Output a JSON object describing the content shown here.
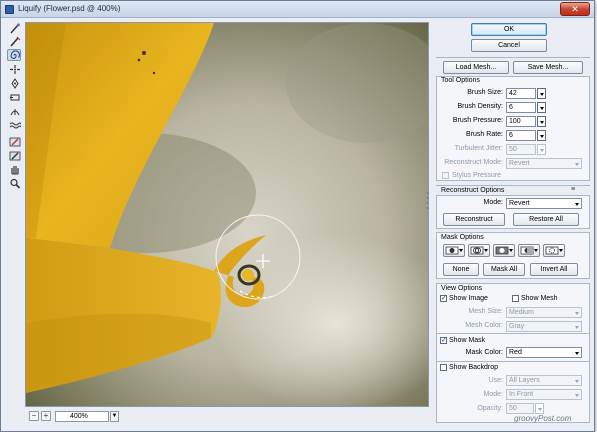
{
  "window": {
    "title": "Liquify (Flower.psd @ 400%)",
    "close_glyph": "✕"
  },
  "toolbar": {
    "tools": [
      "forward-warp-tool",
      "reconstruct-tool",
      "twirl-clockwise-tool",
      "pucker-tool",
      "bloat-tool",
      "push-left-tool",
      "mirror-tool",
      "turbulence-tool",
      "freeze-mask-tool",
      "thaw-mask-tool",
      "hand-tool",
      "zoom-tool"
    ]
  },
  "zoom": {
    "minus": "−",
    "plus": "+",
    "value": "400%"
  },
  "buttons": {
    "ok": "OK",
    "cancel": "Cancel",
    "load_mesh": "Load Mesh...",
    "save_mesh": "Save Mesh..."
  },
  "tool_options": {
    "title": "Tool Options",
    "brush_size_label": "Brush Size:",
    "brush_size": "42",
    "brush_density_label": "Brush Density:",
    "brush_density": "6",
    "brush_pressure_label": "Brush Pressure:",
    "brush_pressure": "100",
    "brush_rate_label": "Brush Rate:",
    "brush_rate": "6",
    "turbulent_jitter_label": "Turbulent Jitter:",
    "turbulent_jitter": "50",
    "reconstruct_mode_label": "Reconstruct Mode:",
    "reconstruct_mode": "Revert",
    "stylus_pressure_label": "Stylus Pressure"
  },
  "reconstruct_options": {
    "title": "Reconstruct Options",
    "mode_label": "Mode:",
    "mode": "Revert",
    "reconstruct_btn": "Reconstruct",
    "restore_all_btn": "Restore All"
  },
  "mask_options": {
    "title": "Mask Options",
    "none_btn": "None",
    "mask_all_btn": "Mask All",
    "invert_all_btn": "Invert All"
  },
  "view_options": {
    "title": "View Options",
    "show_image": "Show Image",
    "show_mesh": "Show Mesh",
    "mesh_size_label": "Mesh Size:",
    "mesh_size": "Medium",
    "mesh_color_label": "Mesh Color:",
    "mesh_color": "Gray",
    "show_mask": "Show Mask",
    "mask_color_label": "Mask Color:",
    "mask_color": "Red",
    "show_backdrop": "Show Backdrop",
    "use_label": "Use:",
    "use": "All Layers",
    "mode_label": "Mode:",
    "mode": "In Front",
    "opacity_label": "Opacity:",
    "opacity": "50"
  },
  "watermark": "groovyPost.com",
  "colors": {
    "petal": "#e0ac1a",
    "background": "#b9b5a5",
    "accent": "#3c7fb1"
  }
}
